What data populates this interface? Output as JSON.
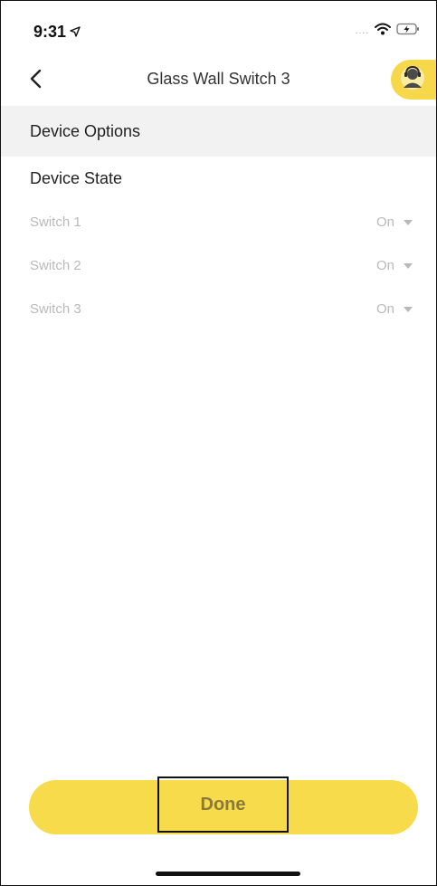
{
  "status_bar": {
    "time": "9:31",
    "location_icon": "location-arrow-icon",
    "signal_icon": "signal-dots-icon",
    "signal_text": "....",
    "wifi_icon": "wifi-icon",
    "battery_icon": "battery-charging-icon"
  },
  "nav": {
    "back_icon": "chevron-left-icon",
    "title": "Glass Wall Switch 3",
    "support_icon": "support-agent-icon"
  },
  "section": {
    "title": "Device Options"
  },
  "device_state": {
    "title": "Device State",
    "switches": [
      {
        "label": "Switch 1",
        "value": "On"
      },
      {
        "label": "Switch 2",
        "value": "On"
      },
      {
        "label": "Switch 3",
        "value": "On"
      }
    ]
  },
  "footer": {
    "done_label": "Done"
  },
  "colors": {
    "accent": "#f7db4a",
    "section_bg": "#f2f2f2",
    "muted_text": "#b9b9b9"
  }
}
